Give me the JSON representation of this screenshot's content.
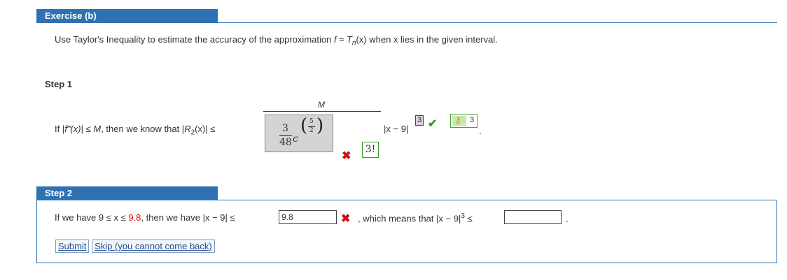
{
  "exercise": {
    "title": "Exercise (b)",
    "instruction_pre": "Use Taylor's Inequality to estimate the accuracy of the approximation ",
    "f": "f",
    "approx": " ≈ ",
    "T": "T",
    "n": "n",
    "x_arg": "(x)",
    "instruction_post": " when x lies in the given interval."
  },
  "step1": {
    "label": "Step 1",
    "text_if": "If |",
    "f_triple": "f‴(x)",
    "text_le_M": "| ≤ ",
    "M": "M",
    "text_then": ", then we know that |",
    "R": "R",
    "R_sub": "2",
    "R_arg": "(x)",
    "text_le": "| ≤",
    "numerator_M": "M",
    "frac_num": "3",
    "frac_den": "48",
    "c": "c",
    "exp_num": "5",
    "exp_den": "2",
    "denominator_answer": "3!",
    "abs_expr": "|x − 9|",
    "power_answer": "3",
    "key_value": "3",
    "period": "."
  },
  "step2": {
    "label": "Step 2",
    "text_pre": "If we have 9 ≤ x ≤ ",
    "upper": "9.8",
    "text_mid": ", then we have |x − 9| ≤",
    "input_value": "9.8",
    "text_means": ", which means that |x − 9|",
    "power": "3",
    "le": "≤",
    "input2_value": "",
    "period": ".",
    "submit_label": "Submit",
    "skip_label": "Skip (you cannot come back)"
  },
  "colors": {
    "accent": "#2f72b3",
    "error": "#d01010",
    "correct": "#3a9a2a"
  }
}
